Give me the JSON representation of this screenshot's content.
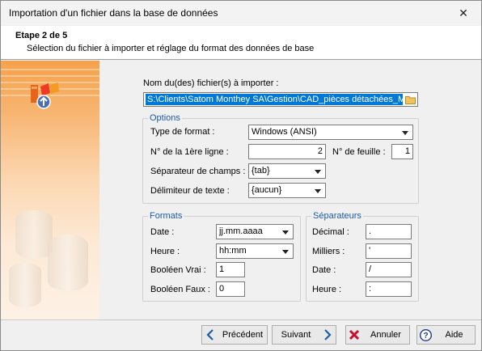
{
  "window": {
    "title": "Importation d'un fichier dans la base de données",
    "close_glyph": "✕"
  },
  "header": {
    "step": "Etape 2 de 5",
    "description": "Sélection du fichier à importer et réglage du format des données de base"
  },
  "file": {
    "label": "Nom du(des) fichier(s) à importer :",
    "path": "S:\\Clients\\Satom Monthey SA\\Gestion\\CAD_pièces détachées_Mec"
  },
  "options": {
    "title": "Options",
    "format_type_label": "Type de format :",
    "format_type_value": "Windows (ANSI)",
    "first_line_label": "N° de la 1ère ligne :",
    "first_line_value": "2",
    "sheet_label": "N° de feuille :",
    "sheet_value": "1",
    "field_sep_label": "Séparateur de champs :",
    "field_sep_value": "{tab}",
    "text_delim_label": "Délimiteur de texte :",
    "text_delim_value": "{aucun}"
  },
  "formats": {
    "title": "Formats",
    "date_label": "Date :",
    "date_value": "jj.mm.aaaa",
    "time_label": "Heure :",
    "time_value": "hh:mm",
    "bool_true_label": "Booléen Vrai :",
    "bool_true_value": "1",
    "bool_false_label": "Booléen Faux :",
    "bool_false_value": "0"
  },
  "separators": {
    "title": "Séparateurs",
    "decimal_label": "Décimal :",
    "decimal_value": ".",
    "thousands_label": "Milliers :",
    "thousands_value": "'",
    "date_label": "Date :",
    "date_value": "/",
    "time_label": "Heure :",
    "time_value": ":"
  },
  "buttons": {
    "previous": "Précédent",
    "next": "Suivant",
    "cancel": "Annuler",
    "help": "Aide"
  },
  "colors": {
    "selection": "#0078d7",
    "group_title": "#1e5aa8",
    "nav_arrow": "#1f5fa8",
    "cancel_icon": "#c8102e",
    "help_icon": "#1e3a8a"
  }
}
